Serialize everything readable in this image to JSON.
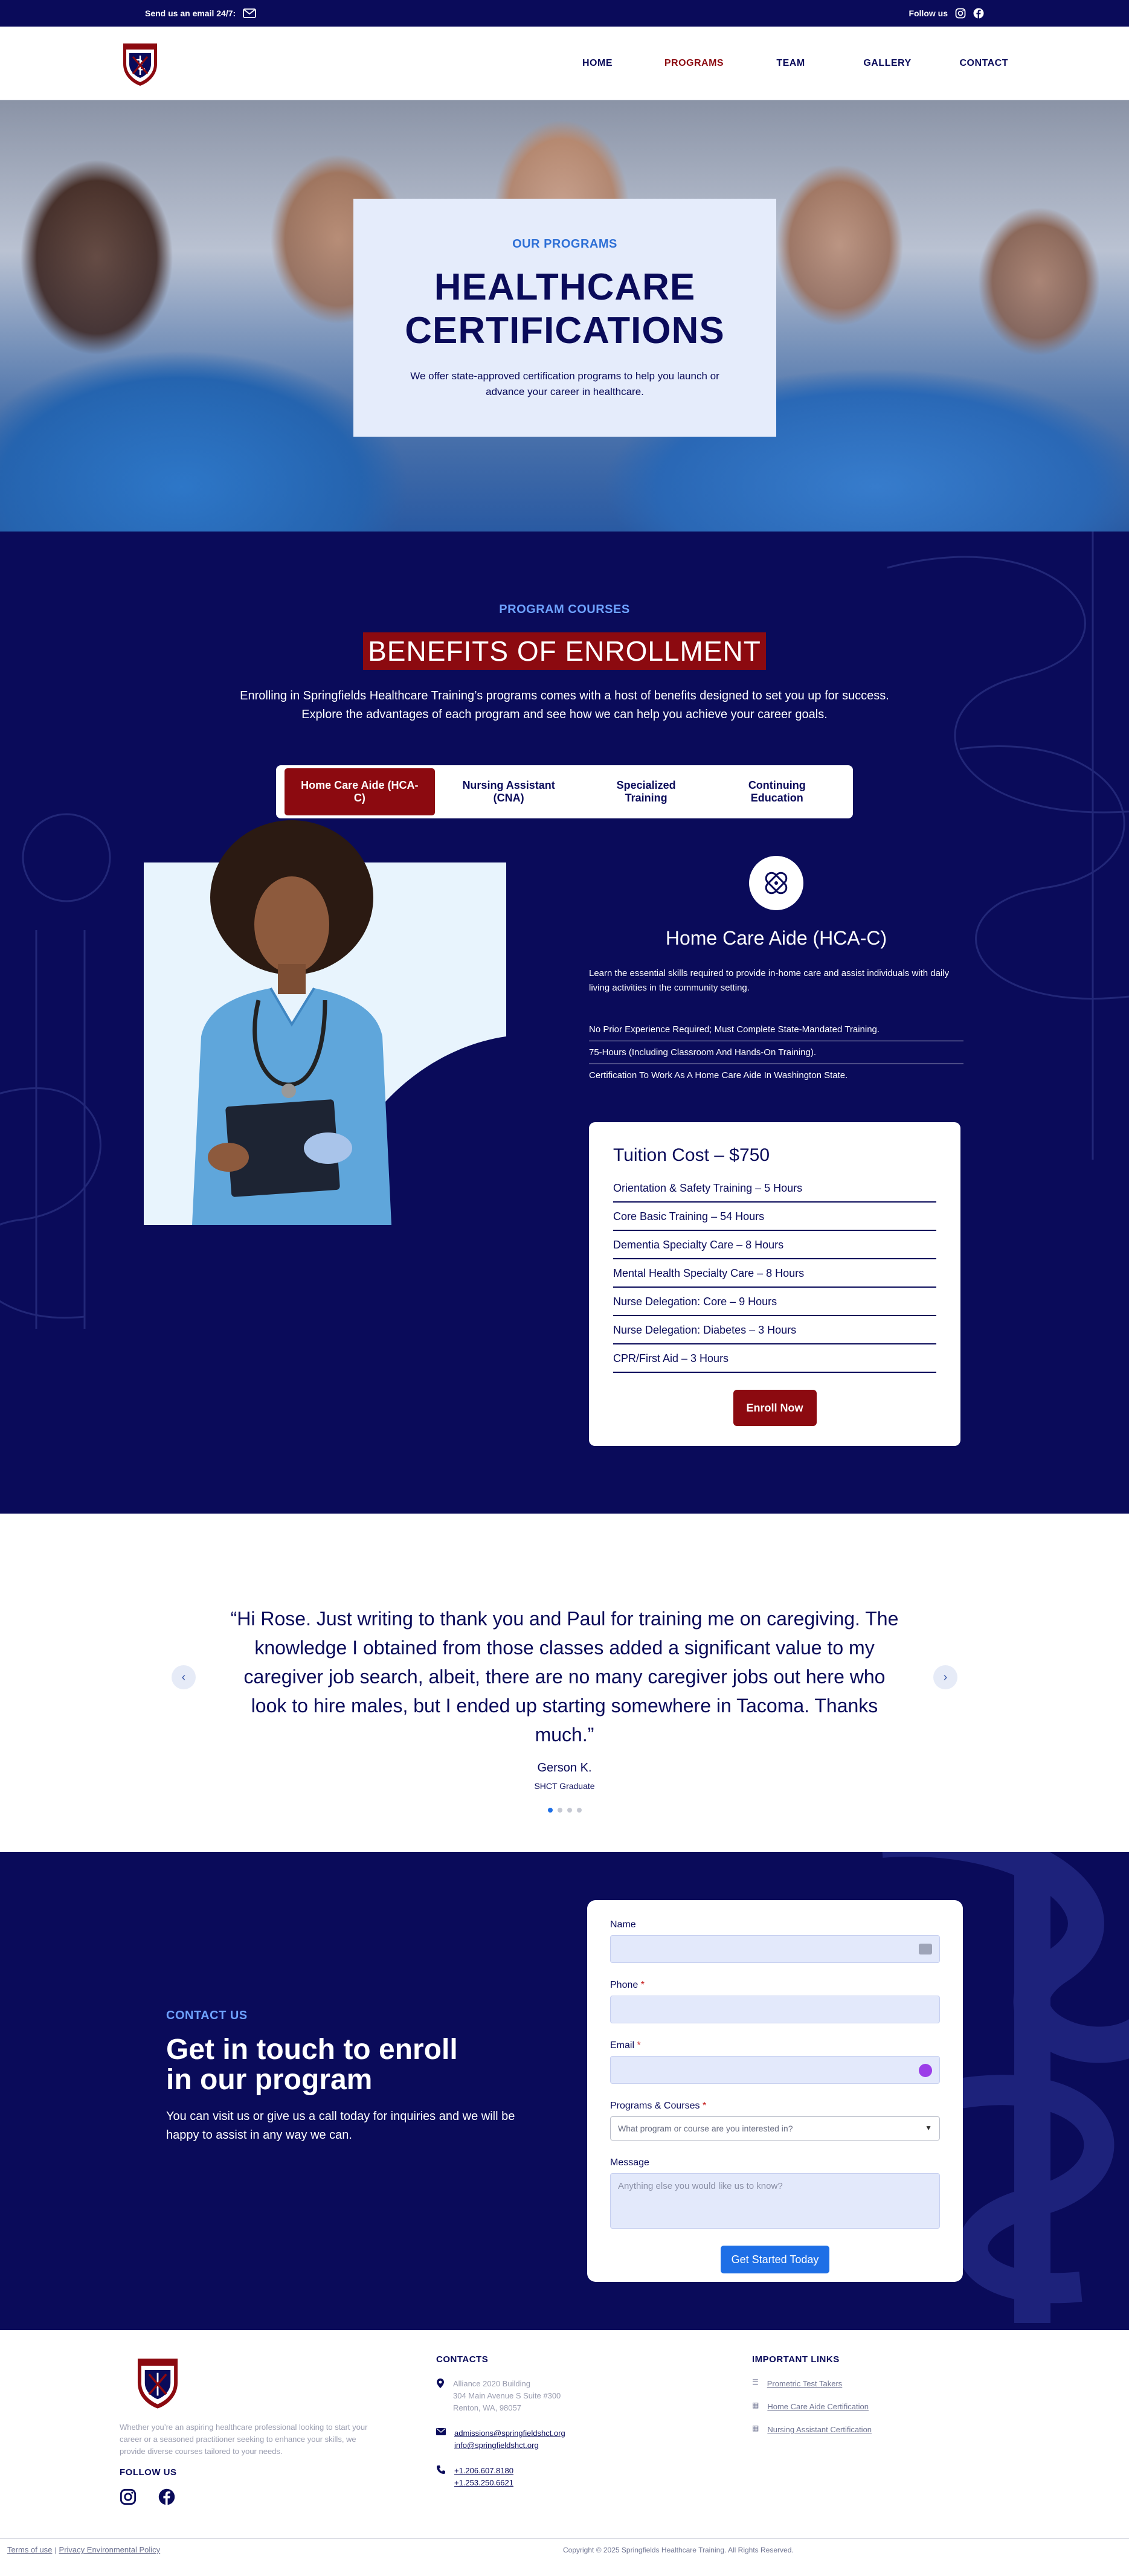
{
  "topbar": {
    "email_label": "Send us an email 24/7:",
    "follow_label": "Follow us"
  },
  "header": {
    "nav": [
      {
        "label": "HOME"
      },
      {
        "label": "PROGRAMS"
      },
      {
        "label": "TEAM"
      },
      {
        "label": "GALLERY"
      },
      {
        "label": "CONTACT"
      }
    ],
    "active_nav": "PROGRAMS"
  },
  "hero": {
    "eyebrow": "OUR PROGRAMS",
    "title_line1": "HEALTHCARE",
    "title_line2": "CERTIFICATIONS",
    "subtitle": "We offer state-approved certification programs to help you launch or advance your career in healthcare."
  },
  "programs": {
    "eyebrow": "PROGRAM COURSES",
    "title": "BENEFITS OF ENROLLMENT",
    "description": "Enrolling in Springfields Healthcare Training’s programs comes with a host of benefits designed to set you up for success. Explore the advantages of each program and see how we can help you achieve your career goals.",
    "tabs": [
      {
        "label": "Home Care Aide (HCA-C)"
      },
      {
        "label": "Nursing Assistant (CNA)"
      },
      {
        "label": "Specialized Training"
      },
      {
        "label": "Continuing Education"
      }
    ],
    "course": {
      "title": "Home Care Aide (HCA-C)",
      "description": "Learn the essential skills required to provide in-home care and assist individuals with daily living activities in the community setting.",
      "requirements": [
        "No Prior Experience Required; Must Complete State-Mandated Training.",
        "75-Hours (Including Classroom And Hands-On Training).",
        "Certification To Work As A Home Care Aide In Washington State."
      ]
    },
    "tuition": {
      "title": "Tuition Cost – $750",
      "items": [
        "Orientation & Safety Training – 5 Hours",
        "Core Basic Training – 54 Hours",
        "Dementia Specialty Care – 8 Hours",
        "Mental Health Specialty Care – 8 Hours",
        "Nurse Delegation: Core – 9 Hours",
        "Nurse Delegation: Diabetes – 3 Hours",
        "CPR/First Aid – 3 Hours"
      ],
      "button": "Enroll Now"
    }
  },
  "testimonial": {
    "quote": "“Hi Rose. Just writing to thank you and Paul for training me on caregiving. The knowledge I obtained from those classes added a significant value to my caregiver job search, albeit, there are no many caregiver jobs out here who look to hire males, but I ended up starting somewhere in Tacoma. Thanks much.”",
    "author": "Gerson K.",
    "role": "SHCT Graduate"
  },
  "contact": {
    "eyebrow": "CONTACT US",
    "title_line1": "Get in touch to enroll",
    "title_line2": "in our program",
    "description": "You can visit us or give us a call today for inquiries and we will be happy to assist in any way we can.",
    "form": {
      "name_label": "Name",
      "phone_label": "Phone",
      "email_label": "Email",
      "programs_label": "Programs & Courses",
      "programs_placeholder": "What program or course are you interested in?",
      "message_label": "Message",
      "message_placeholder": "Anything else you would like us to know?",
      "required_mark": "*",
      "submit": "Get Started Today"
    }
  },
  "footer": {
    "about": "Whether you’re an aspiring healthcare professional looking to start your career or a seasoned practitioner seeking to enhance your skills, we provide diverse courses tailored to your needs.",
    "follow_label": "FOLLOW US",
    "contacts_title": "CONTACTS",
    "address_line1": "Alliance 2020 Building",
    "address_line2": "304 Main Avenue S Suite #300",
    "address_line3": "Renton, WA, 98057",
    "email1": "admissions@springfieldshct.org",
    "email2": "info@springfieldshct.org",
    "phone1": "+1.206.607.8180",
    "phone2": "+1.253.250.6621",
    "links_title": "IMPORTANT LINKS",
    "links": [
      "Prometric Test Takers",
      "Home Care Aide Certification",
      "Nursing Assistant Certification"
    ],
    "terms": "Terms of use",
    "separator": "|",
    "privacy": "Privacy Environmental Policy",
    "copyright": "Copyright © 2025 Springfields Healthcare Training. All Rights Reserved."
  },
  "colors": {
    "navy": "#0a0b5a",
    "crimson": "#8c0a10",
    "accent_blue": "#1e6fe6",
    "light_blue": "#e5ecfb"
  }
}
